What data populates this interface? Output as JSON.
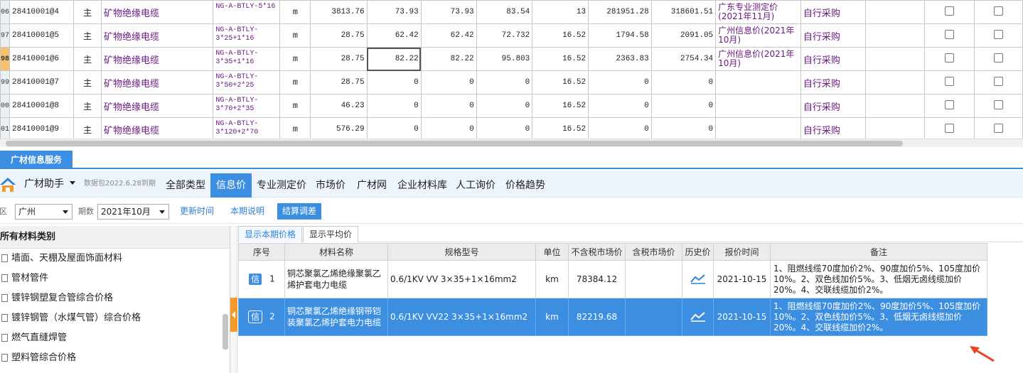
{
  "top_grid": {
    "rows": [
      {
        "rownum": "06",
        "code": "28410001@4",
        "type": "主",
        "name": "矿物绝缘电缆",
        "spec": "NG-A-BTLY-5*16",
        "unit": "m",
        "qty": "3813.76",
        "price1": "73.93",
        "price2": "73.93",
        "price3": "83.54",
        "rate": "13",
        "amount1": "281951.28",
        "amount2": "318601.51",
        "source": "广东专业测定价(2021年11月)",
        "purchase": "自行采购"
      },
      {
        "rownum": "97",
        "code": "28410001@5",
        "type": "主",
        "name": "矿物绝缘电缆",
        "spec": "NG-A-BTLY-3*25+1*16",
        "unit": "m",
        "qty": "28.75",
        "price1": "62.42",
        "price2": "62.42",
        "price3": "72.732",
        "rate": "16.52",
        "amount1": "1794.58",
        "amount2": "2091.05",
        "source": "广州信息价(2021年10月)",
        "purchase": "自行采购"
      },
      {
        "rownum": "98",
        "code": "28410001@6",
        "type": "主",
        "name": "矿物绝缘电缆",
        "spec": "NG-A-BTLY-3*35+1*16",
        "unit": "m",
        "qty": "28.75",
        "price1": "82.22",
        "price2": "82.22",
        "price3": "95.803",
        "rate": "16.52",
        "amount1": "2363.83",
        "amount2": "2754.34",
        "source": "广州信息价(2021年10月)",
        "purchase": "自行采购"
      },
      {
        "rownum": "99",
        "code": "28410001@7",
        "type": "主",
        "name": "矿物绝缘电缆",
        "spec": "NG-A-BTLY-3*50+2*25",
        "unit": "m",
        "qty": "28.75",
        "price1": "0",
        "price2": "0",
        "price3": "0",
        "rate": "16.52",
        "amount1": "0",
        "amount2": "0",
        "source": "",
        "purchase": "自行采购"
      },
      {
        "rownum": "00",
        "code": "28410001@8",
        "type": "主",
        "name": "矿物绝缘电缆",
        "spec": "NG-A-BTLY-3*70+2*35",
        "unit": "m",
        "qty": "46.23",
        "price1": "0",
        "price2": "0",
        "price3": "0",
        "rate": "16.52",
        "amount1": "0",
        "amount2": "0",
        "source": "",
        "purchase": "自行采购"
      },
      {
        "rownum": "01",
        "code": "28410001@9",
        "type": "主",
        "name": "矿物绝缘电缆",
        "spec": "NG-A-BTLY-3*120+2*70",
        "unit": "m",
        "qty": "576.29",
        "price1": "0",
        "price2": "0",
        "price3": "0",
        "rate": "16.52",
        "amount1": "0",
        "amount2": "0",
        "source": "",
        "purchase": "自行采购"
      }
    ]
  },
  "panel": {
    "tab_label": "广材信息服务"
  },
  "toolbar": {
    "brand": "广材助手",
    "package_info": "数据包2022.6.28到期",
    "tabs": [
      "全部类型",
      "信息价",
      "专业测定价",
      "市场价",
      "广材网",
      "企业材料库",
      "人工询价",
      "价格趋势"
    ],
    "active_tab": "信息价"
  },
  "filters": {
    "region_label": "地区",
    "region_value": "广州",
    "period_label": "期数",
    "period_value": "2021年10月",
    "update_button": "更新时间",
    "notes_button": "本期说明",
    "settle_button": "结算调差"
  },
  "categories": {
    "header": "所有材料类别",
    "items": [
      "墙面、天棚及屋面饰面材料",
      "管材管件",
      "镀锌钢塑复合管综合价格",
      "镀锌钢管（水煤气管）综合价格",
      "燃气直缝焊管",
      "塑料管综合价格"
    ]
  },
  "price_panel": {
    "tabs": [
      "显示本期价格",
      "显示平均价"
    ],
    "columns": [
      "序号",
      "材料名称",
      "规格型号",
      "单位",
      "不含税市场价",
      "含税市场价",
      "历史价",
      "报价时间",
      "备注"
    ],
    "rows": [
      {
        "badge": "信",
        "seq": "1",
        "name": "铜芯聚氯乙烯绝缘聚氯乙烯护套电力电缆",
        "spec": "0.6/1KV VV 3×35+1×16mm2",
        "unit": "km",
        "price_ex_tax": "78384.12",
        "price_tax": "",
        "date": "2021-10-15",
        "note": "1、阻燃线缆70度加价2%、90度加价5%、105度加价10%。2、双色线加价5%。3、低烟无卤线缆加价20%。4、交联线缆加价2%。"
      },
      {
        "badge": "信",
        "seq": "2",
        "name": "铜芯聚氯乙烯绝缘钢带铠装聚氯乙烯护套电力电缆",
        "spec": "0.6/1KV VV22 3×35+1×16mm2",
        "unit": "km",
        "price_ex_tax": "82219.68",
        "price_tax": "",
        "date": "2021-10-15",
        "note": "1、阻燃线缆70度加价2%、90度加价5%、105度加价10%。2、双色线加价5%。3、低烟无卤线缆加价20%。4、交联线缆加价2%。"
      }
    ],
    "selected_row": 2
  },
  "colors": {
    "accent": "#3c8ee0",
    "splitter_handle": "#f39a2b",
    "arrow": "#e8442a",
    "purple_text": "#6a1b80"
  },
  "icons": {
    "logo": "guangcai-logo-icon",
    "history": "trend-chart-icon",
    "category": "document-icon"
  }
}
